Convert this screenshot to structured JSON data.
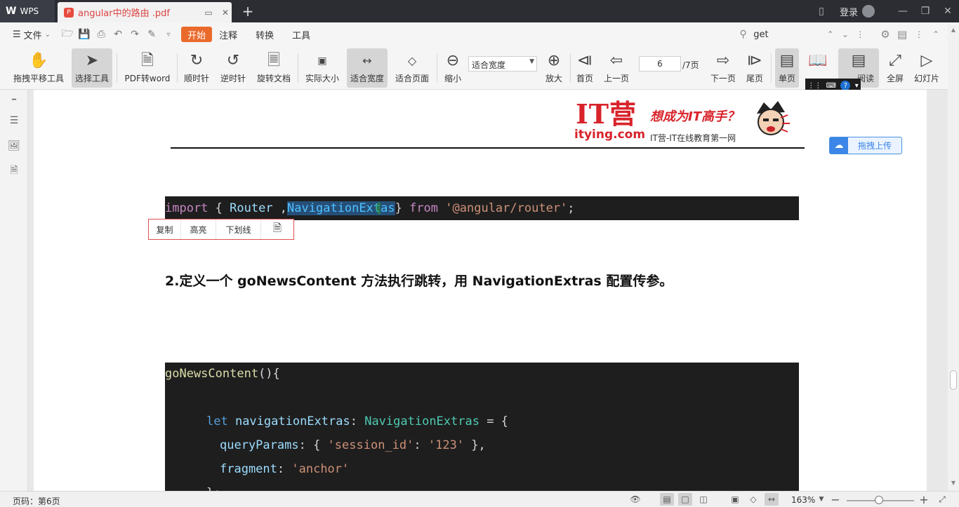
{
  "titlebar": {
    "app_label": "WPS",
    "doc_tab_title": "angular中的路由 .pdf",
    "new_tab": "+",
    "login": "登录"
  },
  "menubar": {
    "file": "文件",
    "start": "开始",
    "annotate": "注释",
    "convert": "转换",
    "tools": "工具",
    "search_value": "get"
  },
  "toolbar": {
    "pan": "拖拽平移工具",
    "select": "选择工具",
    "pdf_to_word": "PDF转word",
    "clockwise": "顺时针",
    "counterclockwise": "逆时针",
    "rotate_doc": "旋转文档",
    "actual_size": "实际大小",
    "fit_width": "适合宽度",
    "fit_page": "适合页面",
    "zoom_out": "缩小",
    "zoom_select": "适合宽度",
    "zoom_in": "放大",
    "first_page": "首页",
    "prev_page": "上一页",
    "page_current": "6",
    "page_total": "/7页",
    "next_page": "下一页",
    "last_page": "尾页",
    "single_page": "单页",
    "reading": "阅读",
    "fullscreen": "全屏",
    "slideshow": "幻灯片"
  },
  "document": {
    "logo": {
      "brand": "IT营",
      "domain": "itying.com",
      "slogan": "想成为IT高手？",
      "subtitle": "IT营-IT在线教育第一网"
    },
    "code1": {
      "import": "import",
      "brace_open": " { ",
      "router": "Router",
      "comma": " ,",
      "selected_a": "NavigationExt",
      "selected_b": "as",
      "brace_close": "} ",
      "from": "from",
      "space": " ",
      "module": "'@angular/router'",
      "semi": ";"
    },
    "popup": {
      "copy": "复制",
      "highlight": "高亮",
      "underline": "下划线"
    },
    "heading": "2.定义一个 goNewsContent 方法执行跳转，用 NavigationExtras 配置传参。",
    "code2": {
      "l1_fn": "goNewsContent",
      "l1_rest": "(){",
      "l2_let": "let",
      "l2_var": " navigationExtras",
      "l2_colon": ": ",
      "l2_type": "NavigationExtras",
      "l2_rest": " = {",
      "l3_key": "queryParams",
      "l3_a": ": { ",
      "l3_str1": "'session_id'",
      "l3_b": ": ",
      "l3_str2": "'123'",
      "l3_c": " },",
      "l4_key": "fragment",
      "l4_a": ": ",
      "l4_str": "'anchor'",
      "l5": "};"
    },
    "upload_button": "拖拽上传"
  },
  "statusbar": {
    "page_label": "页码：第6页",
    "zoom_percent": "163%"
  }
}
